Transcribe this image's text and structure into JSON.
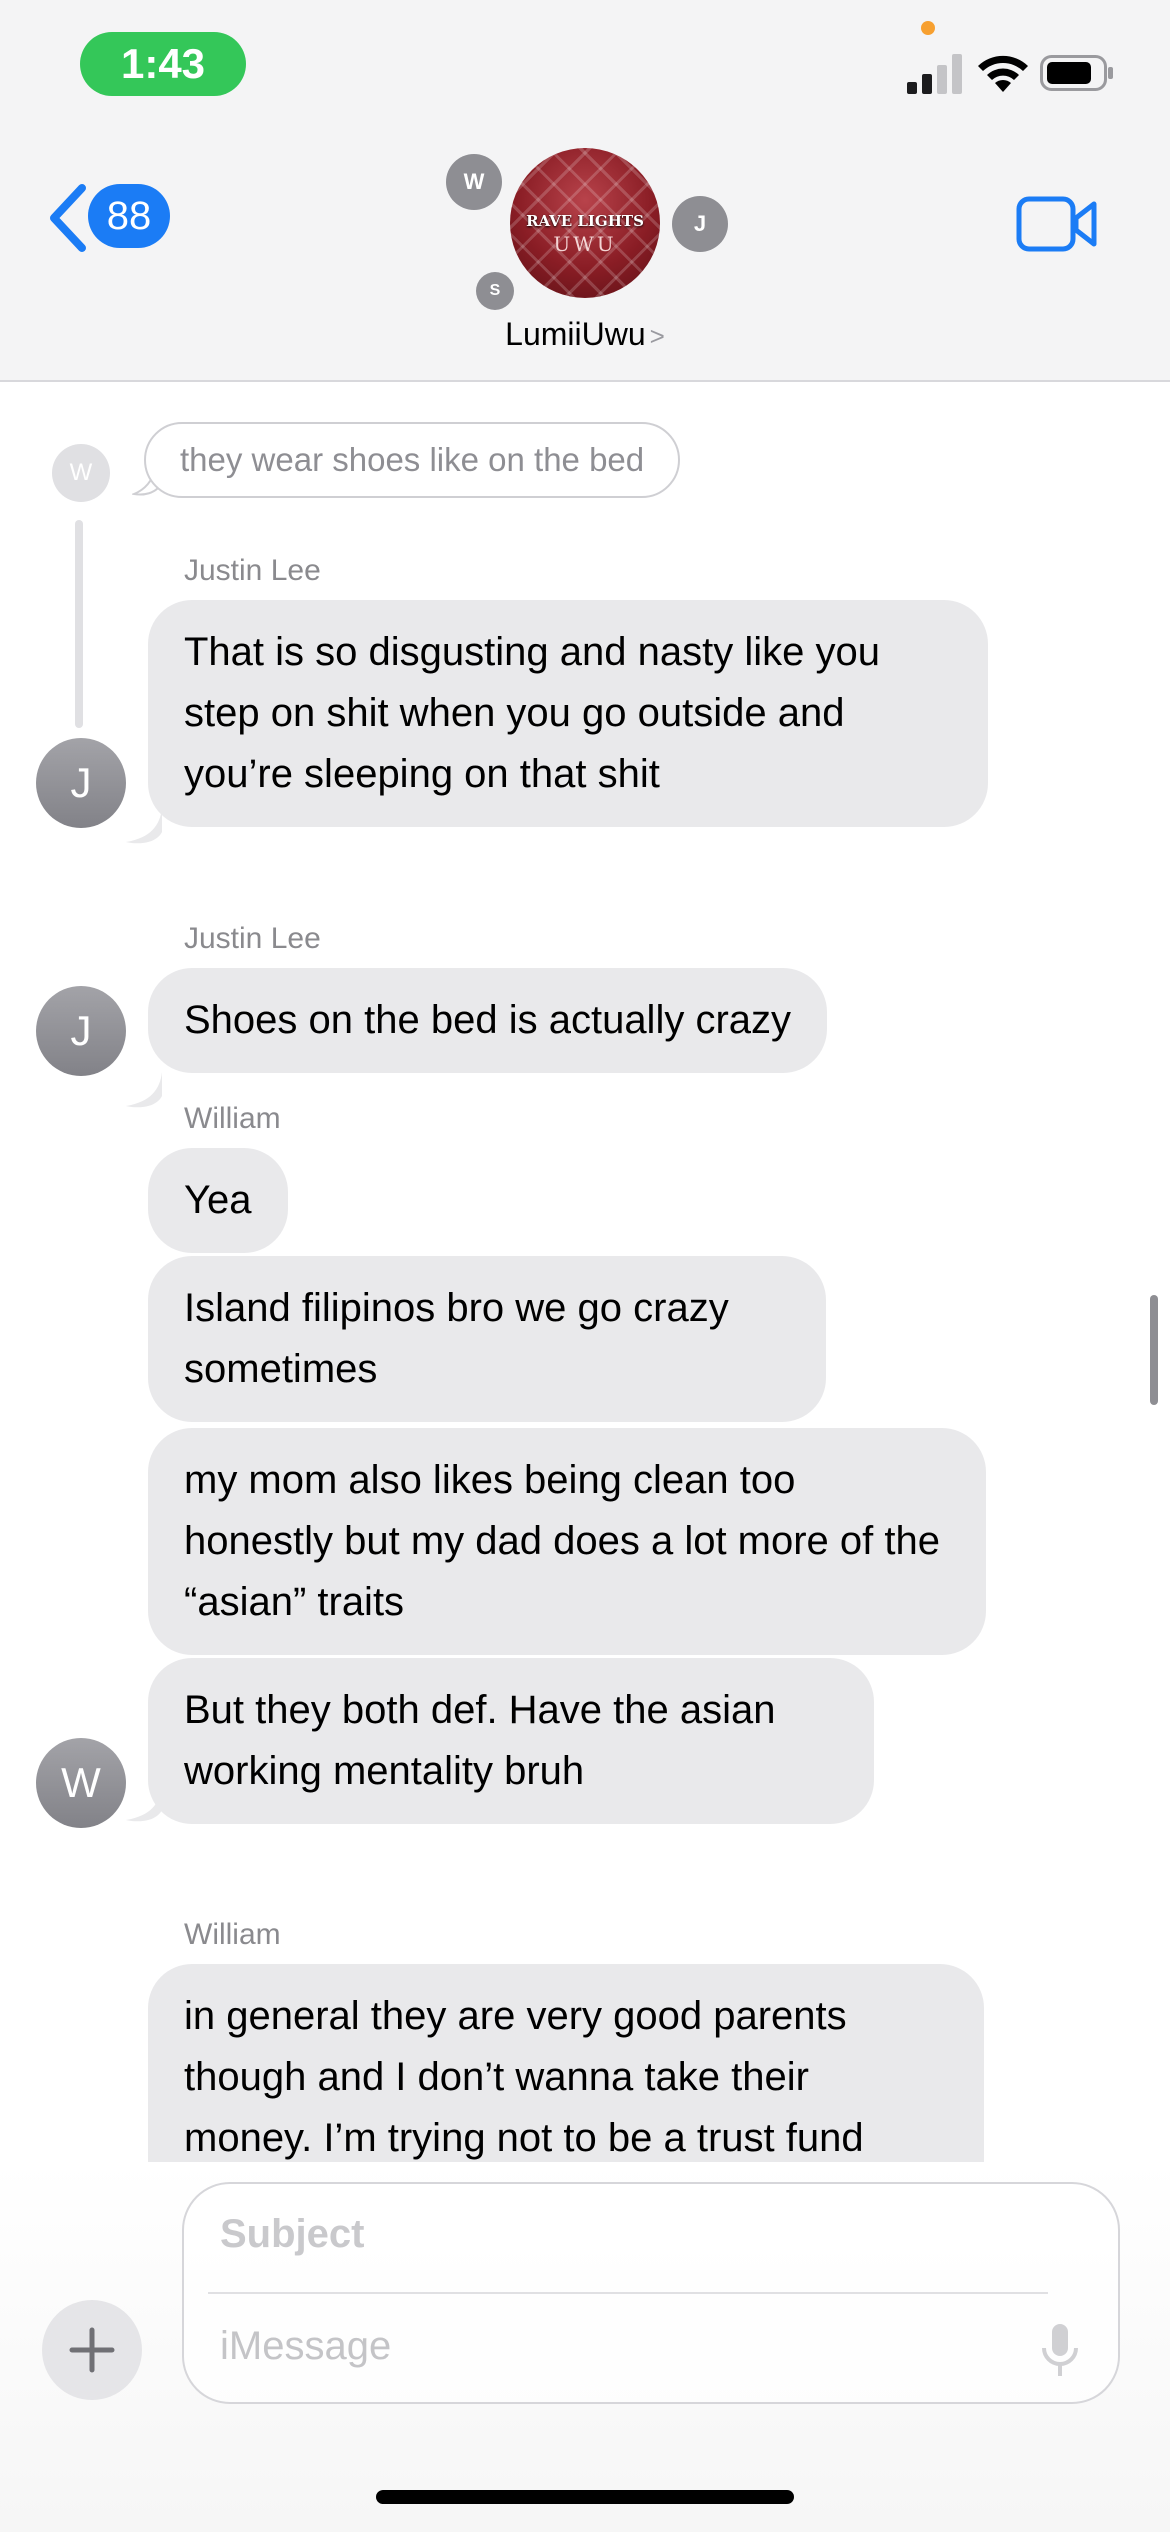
{
  "status_bar": {
    "time": "1:43"
  },
  "header": {
    "back_badge": "88",
    "group_photo_line1": "RAVE LIGHTS",
    "group_photo_line2": "UWU",
    "member_initials": [
      "W",
      "J",
      "S"
    ],
    "group_name": "LumiiUwu",
    "name_chevron": ">"
  },
  "thread": {
    "reply_context": {
      "avatar_initial": "W",
      "text": "they wear shoes like on the bed"
    },
    "groups": [
      {
        "sender": "Justin Lee",
        "avatar_initial": "J",
        "messages": [
          "That is so disgusting and nasty like you step on shit when you go outside and you’re sleeping on that shit"
        ]
      },
      {
        "sender": "Justin Lee",
        "avatar_initial": "J",
        "messages": [
          "Shoes on the bed is actually crazy"
        ]
      },
      {
        "sender": "William",
        "avatar_initial": "W",
        "messages": [
          "Yea",
          "Island filipinos bro we go crazy sometimes",
          "my mom also likes being clean too honestly but my dad does a lot more of the “asian” traits",
          "But they both def. Have the asian working mentality bruh"
        ]
      },
      {
        "sender": "William",
        "messages": [
          "in general they are very good parents though and I don’t wanna take their money. I’m trying not to be a trust fund"
        ]
      }
    ]
  },
  "composer": {
    "subject_placeholder": "Subject",
    "message_placeholder": "iMessage"
  },
  "colors": {
    "accent": "#1b7cf5",
    "time_pill": "#34c759",
    "bubble_received": "#e9e9eb"
  },
  "icons": [
    "back-chevron-icon",
    "video-call-icon",
    "plus-icon",
    "microphone-icon",
    "signal-icon",
    "wifi-icon",
    "battery-icon"
  ]
}
